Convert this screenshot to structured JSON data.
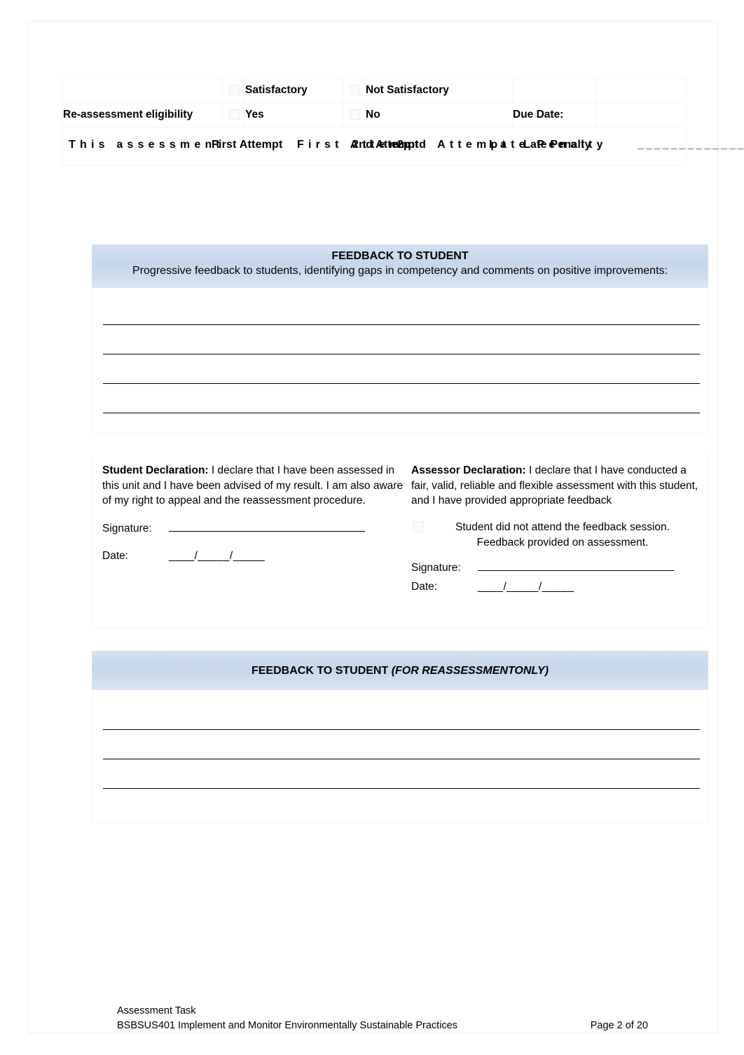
{
  "result_table": {
    "rows": [
      {
        "label": "",
        "options": [
          {
            "checkbox": "satisfactory-checkbox",
            "label": "Satisfactory"
          },
          {
            "checkbox": "not-satisfactory-checkbox",
            "label": "Not Satisfactory"
          }
        ],
        "trailing": ""
      },
      {
        "label": "Re-assessment eligibility",
        "options": [
          {
            "checkbox": "yes-checkbox",
            "label": "Yes"
          },
          {
            "checkbox": "no-checkbox",
            "label": "No"
          }
        ],
        "trailing": "Due Date:"
      }
    ],
    "attempt_row": {
      "lead_text": "This assessment",
      "first_attempt": "First Attempt",
      "second_attempt": "2nd Attempt",
      "late_penalty": "Late Penalty",
      "late_penalty_blank": "______________"
    }
  },
  "feedback_section": {
    "banner_title": "FEEDBACK TO STUDENT",
    "banner_subtitle": "Progressive feedback to students, identifying gaps in competency and comments on positive improvements:",
    "line_count": 4
  },
  "student_declaration": {
    "heading": "Student Declaration:",
    "body": " I declare that I have been assessed in this unit and I have been advised of my result.  I am also aware of my right to appeal and the reassessment procedure.",
    "signature_label": "Signature:",
    "date_label": "Date:",
    "date_blanks": "____/_____/_____"
  },
  "assessor_declaration": {
    "heading": "Assessor Declaration:",
    "body": " I declare that I have conducted a fair, valid, reliable and flexible assessment with this student, and I have provided appropriate feedback",
    "attend_note_line1": "Student did not attend the feedback session.",
    "attend_note_line2": "Feedback provided on assessment.",
    "signature_label": "Signature:",
    "date_label": "Date:",
    "date_blanks": "____/_____/_____"
  },
  "reassessment_section": {
    "banner_title": "FEEDBACK TO STUDENT ",
    "banner_title_italic": "(FOR REASSESSMENTONLY)",
    "line_count": 3
  },
  "footer": {
    "line1": "Assessment Task",
    "line2": "BSBSUS401 Implement and Monitor Environmentally Sustainable Practices",
    "page": "Page 2 of 20"
  },
  "colors": {
    "banner_blue": "#c6d6ec",
    "rule_black": "#000000"
  }
}
